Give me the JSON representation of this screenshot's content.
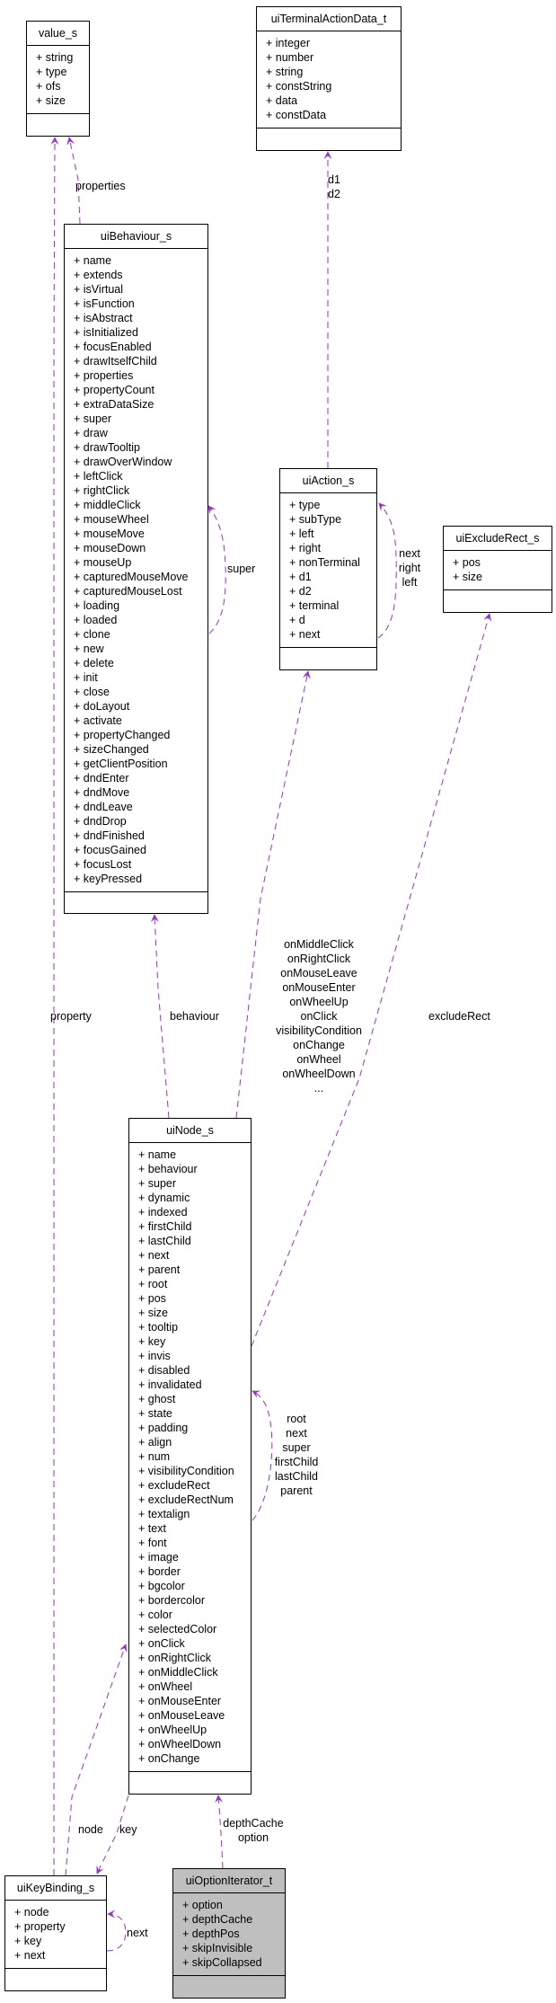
{
  "classes": {
    "value_s": {
      "name": "value_s",
      "attributes": [
        "string",
        "type",
        "ofs",
        "size"
      ]
    },
    "terminal": {
      "name": "uiTerminalActionData_t",
      "attributes": [
        "integer",
        "number",
        "string",
        "constString",
        "data",
        "constData"
      ]
    },
    "behaviour": {
      "name": "uiBehaviour_s",
      "attributes": [
        "name",
        "extends",
        "isVirtual",
        "isFunction",
        "isAbstract",
        "isInitialized",
        "focusEnabled",
        "drawItselfChild",
        "properties",
        "propertyCount",
        "extraDataSize",
        "super",
        "draw",
        "drawTooltip",
        "drawOverWindow",
        "leftClick",
        "rightClick",
        "middleClick",
        "mouseWheel",
        "mouseMove",
        "mouseDown",
        "mouseUp",
        "capturedMouseMove",
        "capturedMouseLost",
        "loading",
        "loaded",
        "clone",
        "new",
        "delete",
        "init",
        "close",
        "doLayout",
        "activate",
        "propertyChanged",
        "sizeChanged",
        "getClientPosition",
        "dndEnter",
        "dndMove",
        "dndLeave",
        "dndDrop",
        "dndFinished",
        "focusGained",
        "focusLost",
        "keyPressed"
      ]
    },
    "action": {
      "name": "uiAction_s",
      "attributes": [
        "type",
        "subType",
        "left",
        "right",
        "nonTerminal",
        "d1",
        "d2",
        "terminal",
        "d",
        "next"
      ]
    },
    "exclude": {
      "name": "uiExcludeRect_s",
      "attributes": [
        "pos",
        "size"
      ]
    },
    "node": {
      "name": "uiNode_s",
      "attributes": [
        "name",
        "behaviour",
        "super",
        "dynamic",
        "indexed",
        "firstChild",
        "lastChild",
        "next",
        "parent",
        "root",
        "pos",
        "size",
        "tooltip",
        "key",
        "invis",
        "disabled",
        "invalidated",
        "ghost",
        "state",
        "padding",
        "align",
        "num",
        "visibilityCondition",
        "excludeRect",
        "excludeRectNum",
        "textalign",
        "text",
        "font",
        "image",
        "border",
        "bgcolor",
        "bordercolor",
        "color",
        "selectedColor",
        "onClick",
        "onRightClick",
        "onMiddleClick",
        "onWheel",
        "onMouseEnter",
        "onMouseLeave",
        "onWheelUp",
        "onWheelDown",
        "onChange"
      ]
    },
    "keybinding": {
      "name": "uiKeyBinding_s",
      "attributes": [
        "node",
        "property",
        "key",
        "next"
      ]
    },
    "iterator": {
      "name": "uiOptionIterator_t",
      "attributes": [
        "option",
        "depthCache",
        "depthPos",
        "skipInvisible",
        "skipCollapsed"
      ],
      "highlighted": true
    }
  },
  "edge_labels": {
    "properties": [
      "properties"
    ],
    "d1d2": [
      "d1",
      "d2"
    ],
    "super_behaviour": [
      "super"
    ],
    "action_self": [
      "next",
      "right",
      "left"
    ],
    "property": [
      "property"
    ],
    "behaviour": [
      "behaviour"
    ],
    "actions": [
      "onMiddleClick",
      "onRightClick",
      "onMouseLeave",
      "onMouseEnter",
      "onWheelUp",
      "onClick",
      "visibilityCondition",
      "onChange",
      "onWheel",
      "onWheelDown",
      "..."
    ],
    "excludeRect": [
      "excludeRect"
    ],
    "node_self": [
      "root",
      "next",
      "super",
      "firstChild",
      "lastChild",
      "parent"
    ],
    "node": [
      "node"
    ],
    "key": [
      "key"
    ],
    "iterator": [
      "depthCache",
      "option"
    ],
    "keybinding_self": [
      "next"
    ]
  },
  "colors": {
    "edge": "#9a32cd",
    "highlight": "#bfbfbf"
  },
  "attribute_prefix": "+ "
}
